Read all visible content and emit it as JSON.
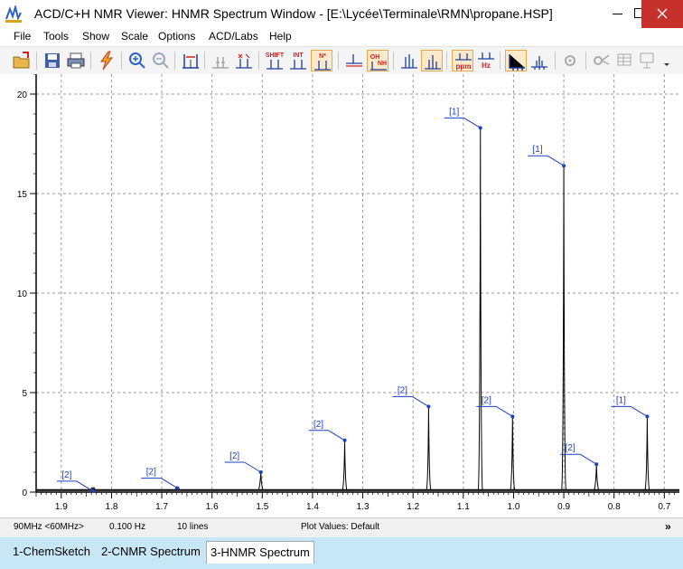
{
  "window": {
    "title": "ACD/C+H NMR Viewer: HNMR Spectrum Window - [E:\\Lycée\\Terminale\\RMN\\propane.HSP]",
    "close_glyph": "✕"
  },
  "menu": [
    "File",
    "Tools",
    "Show",
    "Scale",
    "Options",
    "ACD/Labs",
    "Help"
  ],
  "toolbar": {
    "shift_label": "SHIFT",
    "int_label": "INT",
    "nh_label": "N*",
    "oh_label": "OH",
    "oh_sub": "NH",
    "ppm_label": "ppm",
    "hz_label": "Hz"
  },
  "status": {
    "field": "90MHz <60MHz>",
    "resolution": "0.100 Hz",
    "lines": "10 lines",
    "plot_values": "Plot Values: Default",
    "more": "»"
  },
  "tabs": [
    {
      "label": "1-ChemSketch",
      "active": false
    },
    {
      "label": "2-CNMR Spectrum",
      "active": false
    },
    {
      "label": "3-HNMR Spectrum",
      "active": true
    }
  ],
  "chart_data": {
    "type": "line",
    "xlabel": "",
    "ylabel": "",
    "x_reversed": true,
    "xlim": [
      1.95,
      0.67
    ],
    "ylim": [
      0,
      21
    ],
    "x_ticks": [
      "1.9",
      "1.8",
      "1.7",
      "1.6",
      "1.5",
      "1.4",
      "1.3",
      "1.2",
      "1.1",
      "1.0",
      "0.9",
      "0.8",
      "0.7"
    ],
    "y_ticks": [
      "0",
      "5",
      "10",
      "15",
      "20"
    ],
    "grid": true,
    "peaks": [
      {
        "ppm": 1.837,
        "height": 0.05,
        "label": "[2]"
      },
      {
        "ppm": 1.669,
        "height": 0.2,
        "label": "[2]"
      },
      {
        "ppm": 1.503,
        "height": 1.0,
        "label": "[2]"
      },
      {
        "ppm": 1.336,
        "height": 2.6,
        "label": "[2]"
      },
      {
        "ppm": 1.169,
        "height": 4.3,
        "label": "[2]"
      },
      {
        "ppm": 1.066,
        "height": 18.3,
        "label": "[1]"
      },
      {
        "ppm": 1.002,
        "height": 3.8,
        "label": "[2]"
      },
      {
        "ppm": 0.9,
        "height": 16.4,
        "label": "[1]"
      },
      {
        "ppm": 0.835,
        "height": 1.4,
        "label": "[2]"
      },
      {
        "ppm": 0.734,
        "height": 3.8,
        "label": "[1]"
      }
    ]
  }
}
